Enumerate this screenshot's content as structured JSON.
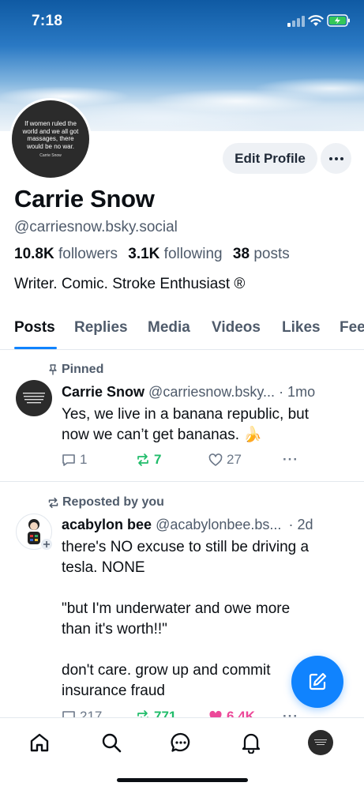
{
  "status_bar": {
    "time": "7:18"
  },
  "avatar": {
    "quote": "If women ruled the world and we all got massages, there would be no war.",
    "attribution": "Carrie Snow"
  },
  "profile": {
    "edit_label": "Edit Profile",
    "more_label": "···",
    "display_name": "Carrie Snow",
    "handle": "@carriesnow.bsky.social",
    "followers_count": "10.8K",
    "followers_label": "followers",
    "following_count": "3.1K",
    "following_label": "following",
    "posts_count": "38",
    "posts_label": "posts",
    "bio": "Writer. Comic. Stroke Enthusiast ®"
  },
  "tabs": [
    {
      "label": "Posts",
      "active": true
    },
    {
      "label": "Replies"
    },
    {
      "label": "Media"
    },
    {
      "label": "Videos"
    },
    {
      "label": "Likes"
    },
    {
      "label": "Fee"
    }
  ],
  "posts": [
    {
      "context": "Pinned",
      "author": "Carrie Snow",
      "handle": "@carriesnow.bsky...",
      "time": "· 1mo",
      "text_line1": "Yes, we live in a banana republic, but",
      "text_line2": "now we can’t get bananas. 🍌",
      "replies": "1",
      "reposts": "7",
      "likes": "27",
      "more": "···"
    },
    {
      "context": "Reposted by you",
      "author": "acabylon bee",
      "handle": "@acabylonbee.bs...",
      "time": "· 2d",
      "lines": [
        "there's NO excuse to still be driving a",
        "tesla. NONE",
        "",
        "\"but I'm underwater and owe more",
        "than it's worth!!\"",
        "",
        "don't care. grow up and commit",
        "insurance fraud"
      ],
      "replies": "217",
      "reposts": "771",
      "likes": "6.4K",
      "more": "···"
    }
  ],
  "colors": {
    "accent": "#1083fe",
    "repost_green": "#20bc6a",
    "like_pink": "#ec4899",
    "muted": "#4f5b6b"
  },
  "nav": [
    "home-icon",
    "search-icon",
    "chat-icon",
    "bell-icon",
    "profile-avatar"
  ]
}
